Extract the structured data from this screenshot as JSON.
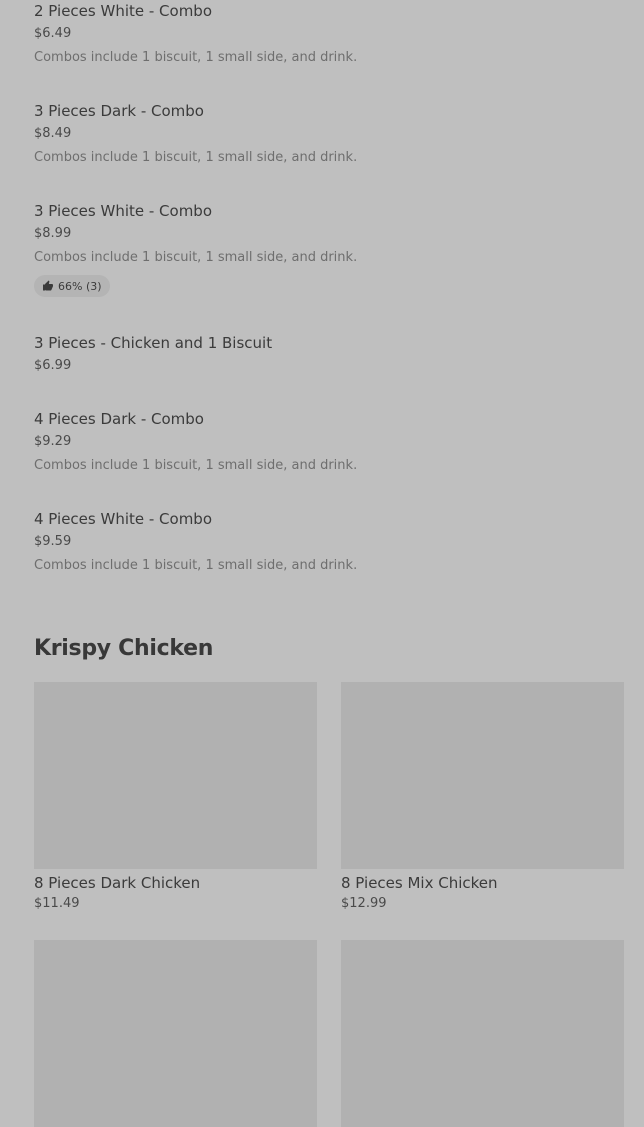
{
  "menu_items": [
    {
      "name": "2 Pieces White - Combo",
      "price": "$6.49",
      "description": "Combos include 1 biscuit, 1 small side, and drink."
    },
    {
      "name": "3 Pieces Dark - Combo",
      "price": "$8.49",
      "description": "Combos include 1 biscuit, 1 small side, and drink."
    },
    {
      "name": "3 Pieces White - Combo",
      "price": "$8.99",
      "description": "Combos include 1 biscuit, 1 small side, and drink.",
      "rating": "66% (3)"
    },
    {
      "name": "3 Pieces - Chicken and 1 Biscuit",
      "price": "$6.99"
    },
    {
      "name": "4 Pieces Dark - Combo",
      "price": "$9.29",
      "description": "Combos include 1 biscuit, 1 small side, and drink."
    },
    {
      "name": "4 Pieces White - Combo",
      "price": "$9.59",
      "description": "Combos include 1 biscuit, 1 small side, and drink."
    }
  ],
  "section": {
    "title": "Krispy Chicken",
    "cards": [
      {
        "name": "8 Pieces Dark Chicken",
        "price": "$11.49"
      },
      {
        "name": "8 Pieces Mix Chicken",
        "price": "$12.99"
      }
    ]
  },
  "icons": {
    "rating": "thumbs-up-icon"
  },
  "colors": {
    "background": "#bfbfbf",
    "image_placeholder": "#b1b1b1",
    "badge": "#b4b4b4"
  }
}
